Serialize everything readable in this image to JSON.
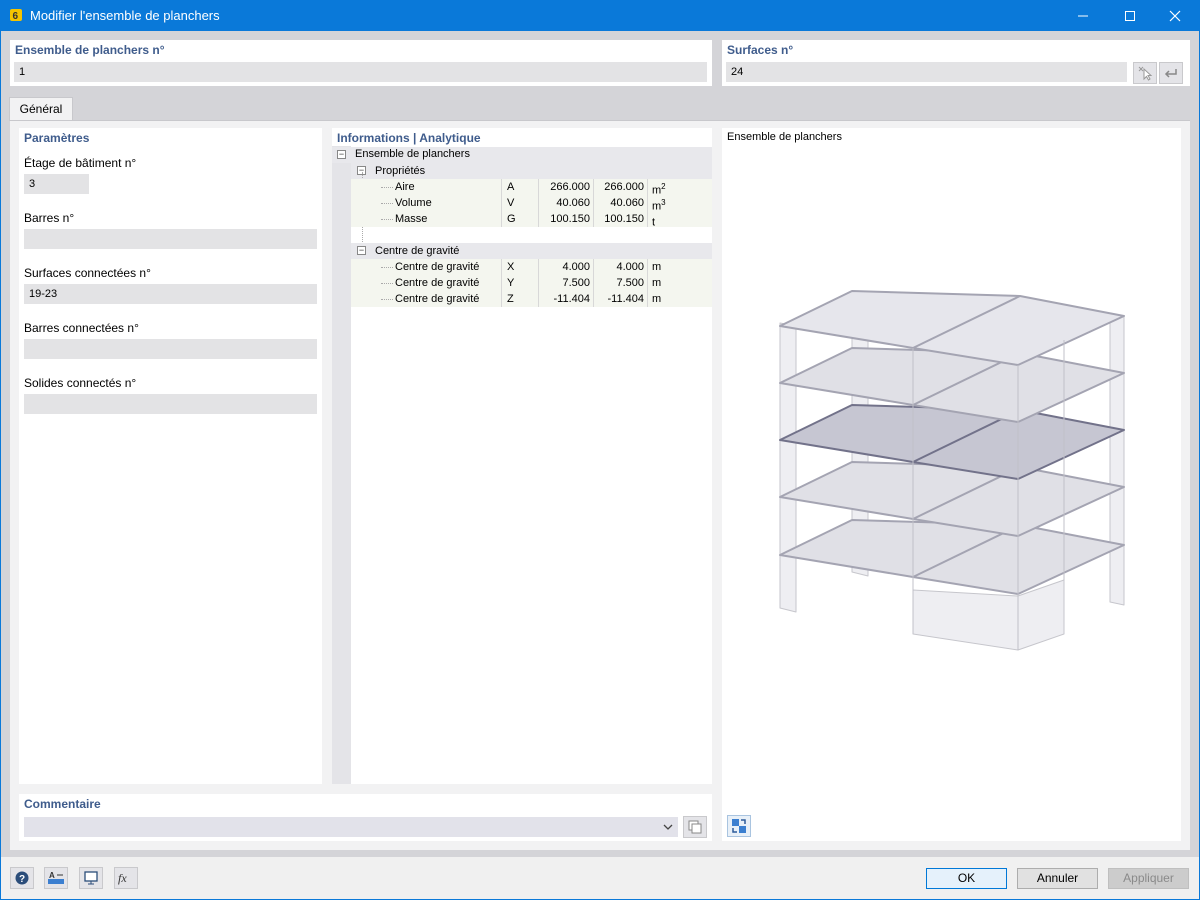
{
  "window": {
    "title": "Modifier l'ensemble de planchers"
  },
  "header": {
    "set_label": "Ensemble de planchers n°",
    "set_value": "1",
    "surfaces_label": "Surfaces n°",
    "surfaces_value": "24"
  },
  "tabs": [
    {
      "label": "Général"
    }
  ],
  "params": {
    "title": "Paramètres",
    "fields": [
      {
        "label": "Étage de bâtiment n°",
        "value": "3"
      },
      {
        "label": "Barres n°",
        "value": ""
      },
      {
        "label": "Surfaces connectées n°",
        "value": "19-23"
      },
      {
        "label": "Barres connectées n°",
        "value": ""
      },
      {
        "label": "Solides connectés n°",
        "value": ""
      }
    ]
  },
  "info": {
    "title": "Informations | Analytique",
    "root": "Ensemble de planchers",
    "groups": [
      {
        "name": "Propriétés",
        "rows": [
          {
            "name": "Aire",
            "sym": "A",
            "v1": "266.000",
            "v2": "266.000",
            "unit": "m",
            "sup": "2"
          },
          {
            "name": "Volume",
            "sym": "V",
            "v1": "40.060",
            "v2": "40.060",
            "unit": "m",
            "sup": "3"
          },
          {
            "name": "Masse",
            "sym": "G",
            "v1": "100.150",
            "v2": "100.150",
            "unit": "t",
            "sup": ""
          }
        ]
      },
      {
        "name": "Centre de gravité",
        "rows": [
          {
            "name": "Centre de gravité",
            "sym": "X",
            "v1": "4.000",
            "v2": "4.000",
            "unit": "m",
            "sup": ""
          },
          {
            "name": "Centre de gravité",
            "sym": "Y",
            "v1": "7.500",
            "v2": "7.500",
            "unit": "m",
            "sup": ""
          },
          {
            "name": "Centre de gravité",
            "sym": "Z",
            "v1": "-11.404",
            "v2": "-11.404",
            "unit": "m",
            "sup": ""
          }
        ]
      }
    ]
  },
  "preview": {
    "title": "Ensemble de planchers"
  },
  "comment": {
    "label": "Commentaire",
    "value": ""
  },
  "buttons": {
    "ok": "OK",
    "cancel": "Annuler",
    "apply": "Appliquer"
  },
  "colors": {
    "titlebar": "#0a79d9",
    "section_label": "#3f5c8c",
    "selected_floor": "#9e9eb0"
  }
}
